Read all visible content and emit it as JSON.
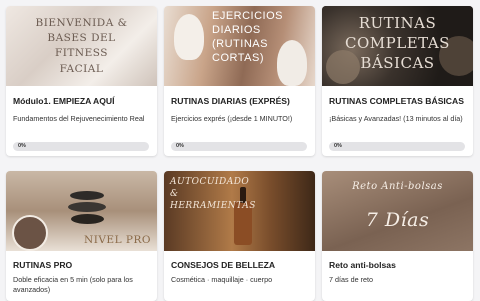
{
  "courses": [
    {
      "thumb_lines": [
        "BIENVENIDA &",
        "BASES DEL",
        "FITNESS",
        "FACIAL"
      ],
      "title": "Módulo1. EMPIEZA AQUÍ",
      "description": "Fundamentos del Rejuvenecimiento Real",
      "progress": "0%",
      "progress_value": 0
    },
    {
      "thumb_lines": [
        "EJERCICIOS",
        "DIARIOS",
        "(RUTINAS",
        "CORTAS)"
      ],
      "title": "RUTINAS DIARIAS (EXPRÉS)",
      "description": "Ejercicios exprés (¡desde 1 MINUTO!)",
      "progress": "0%",
      "progress_value": 0
    },
    {
      "thumb_lines": [
        "RUTINAS",
        "COMPLETAS",
        "BÁSICAS"
      ],
      "title": "RUTINAS COMPLETAS BÁSICAS",
      "description": "¡Básicas y Avanzadas! (13 minutos al día)",
      "progress": "0%",
      "progress_value": 0
    },
    {
      "thumb_lines": [
        "NIVEL PRO"
      ],
      "title": "RUTINAS PRO",
      "description": "Doble eficacia en 5 min (solo para los avanzados)"
    },
    {
      "thumb_lines": [
        "AUTOCUIDADO",
        "&",
        "HERRAMIENTAS"
      ],
      "title": "CONSEJOS DE BELLEZA",
      "description": "Cosmética · maquillaje · cuerpo"
    },
    {
      "thumb_lines": [
        "Reto Anti-bolsas",
        "7 Días"
      ],
      "title": "Reto anti-bolsas",
      "description": "7 días de reto"
    }
  ],
  "colors": {
    "progress_fill": "#4c8dd6",
    "progress_track": "#e3e3e6",
    "page_bg": "#f4f4f6"
  }
}
